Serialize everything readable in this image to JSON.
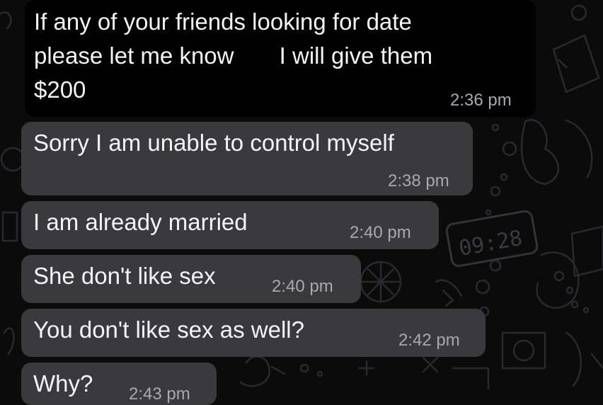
{
  "colors": {
    "wallpaper": "#0b0b0c",
    "outgoing_bubble": "#000000",
    "incoming_bubble": "#3a3a3d",
    "text": "#f4f4f4",
    "timestamp": "#a9a9ad"
  },
  "wallpaper_clock": "09:28",
  "messages": [
    {
      "direction": "outgoing",
      "lines": [
        "If any of your friends looking for date",
        "please let me know       I will give them",
        "$200"
      ],
      "time": "2:36 pm"
    },
    {
      "direction": "incoming",
      "lines": [
        "Sorry I am unable to control myself"
      ],
      "time": "2:38 pm"
    },
    {
      "direction": "incoming",
      "lines": [
        "I am already married"
      ],
      "time": "2:40 pm"
    },
    {
      "direction": "incoming",
      "lines": [
        "She don't like sex"
      ],
      "time": "2:40 pm"
    },
    {
      "direction": "incoming",
      "lines": [
        "You don't like sex as well?"
      ],
      "time": "2:42 pm"
    },
    {
      "direction": "incoming",
      "lines": [
        "Why?"
      ],
      "time": "2:43 pm"
    }
  ]
}
